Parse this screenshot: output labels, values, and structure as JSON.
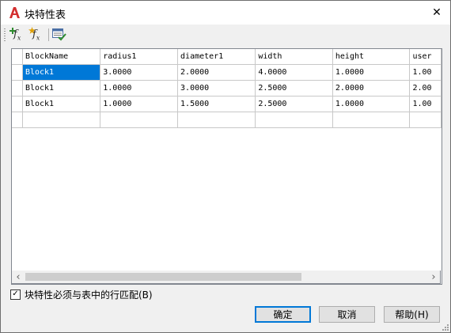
{
  "window": {
    "title": "块特性表",
    "close_glyph": "✕"
  },
  "toolbar": {
    "add_param_icon": "add-parameter-icon",
    "add_constraint_icon": "add-user-parameter-icon",
    "audit_icon": "audit-icon",
    "fx_label": "f",
    "fx_sub": "x"
  },
  "grid": {
    "columns": [
      "BlockName",
      "radius1",
      "diameter1",
      "width",
      "height",
      "user"
    ],
    "rows": [
      [
        "Block1",
        "3.0000",
        "2.0000",
        "4.0000",
        "1.0000",
        "1.00"
      ],
      [
        "Block1",
        "1.0000",
        "3.0000",
        "2.5000",
        "2.0000",
        "2.00"
      ],
      [
        "Block1",
        "1.0000",
        "1.5000",
        "2.5000",
        "1.0000",
        "1.00"
      ]
    ],
    "selected_cell": "Block1"
  },
  "scrollbar": {
    "left_arrow": "‹",
    "right_arrow": "›"
  },
  "option": {
    "label": "块特性必须与表中的行匹配(B)",
    "checked": true,
    "check_glyph": "✓"
  },
  "buttons": {
    "ok": "确定",
    "cancel": "取消",
    "help": "帮助(H)"
  },
  "colors": {
    "accent": "#0078d7",
    "app_icon": "#d32f2f",
    "add_icon": "#2e8b2e",
    "add_user_icon": "#e0a000"
  }
}
